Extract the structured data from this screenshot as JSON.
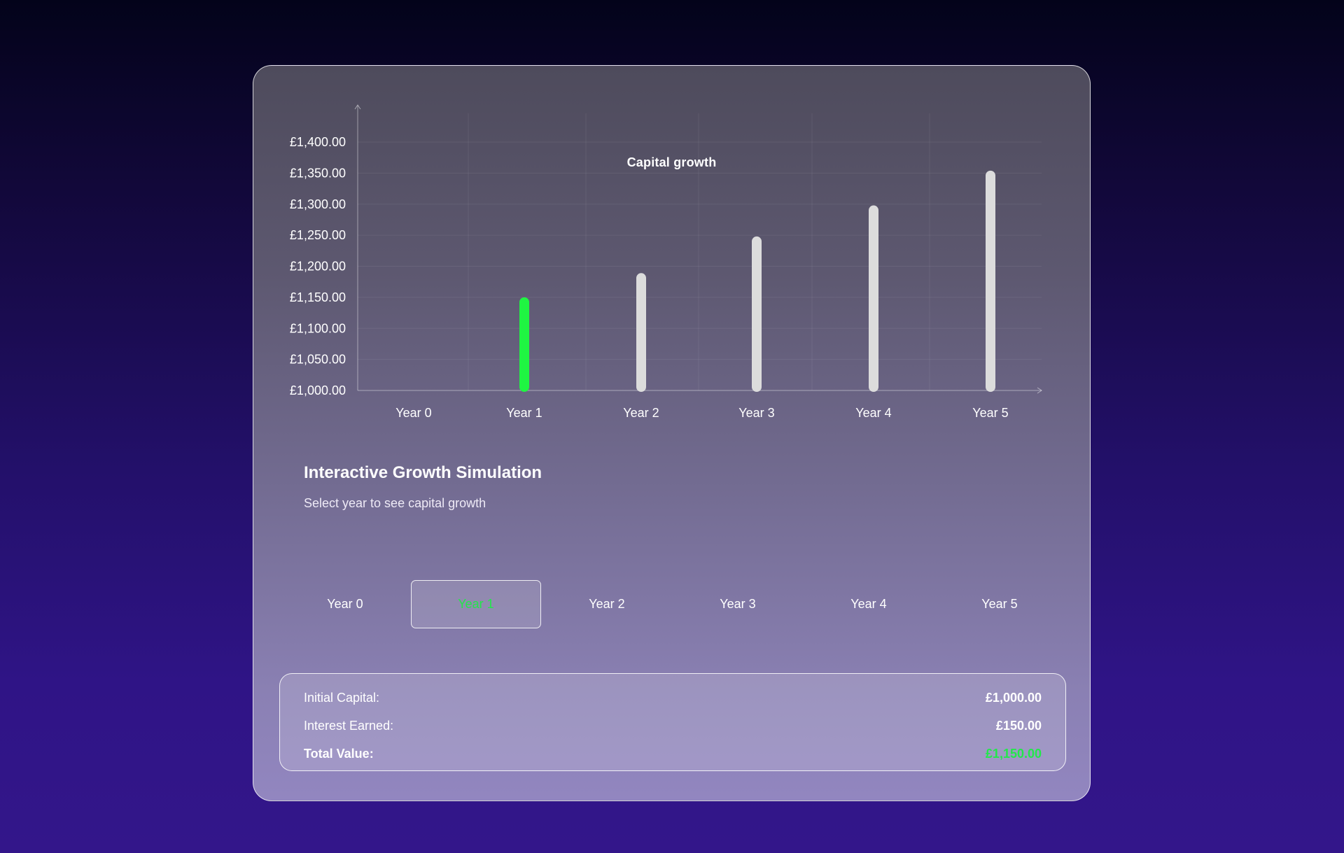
{
  "colors": {
    "accent": "#22e84a",
    "bar_default": "#dcdcdc",
    "bar_selected": "#1ff542"
  },
  "chart_data": {
    "type": "bar",
    "title": "Capital growth",
    "categories": [
      "Year 0",
      "Year 1",
      "Year 2",
      "Year 3",
      "Year 4",
      "Year 5"
    ],
    "series": [
      {
        "values": [
          1000.0,
          1150.0,
          1189.0,
          1248.0,
          1298.0,
          1354.0
        ]
      }
    ],
    "y_ticks": [
      "£1,000.00",
      "£1,050.00",
      "£1,100.00",
      "£1,150.00",
      "£1,200.00",
      "£1,250.00",
      "£1,300.00",
      "£1,350.00",
      "£1,400.00"
    ],
    "ylim": [
      1000,
      1400
    ],
    "selected_index": 1,
    "grid": true
  },
  "simulation": {
    "title": "Interactive Growth Simulation",
    "subtitle": "Select year to see capital growth",
    "tabs": [
      "Year 0",
      "Year 1",
      "Year 2",
      "Year 3",
      "Year 4",
      "Year 5"
    ],
    "active_tab": "Year 1"
  },
  "summary": {
    "initial_label": "Initial Capital:",
    "initial_value": "£1,000.00",
    "interest_label": "Interest Earned:",
    "interest_value": "£150.00",
    "total_label": "Total Value:",
    "total_value": "£1,150.00"
  }
}
